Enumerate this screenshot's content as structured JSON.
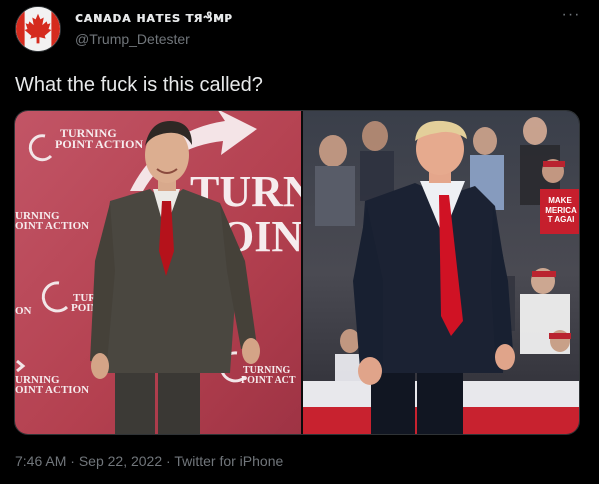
{
  "author": {
    "display_name": "ᴄᴀɴᴀᴅᴀ нᴀᴛᴇs тя₰ᴍᴘ",
    "handle": "@Trump_Detester",
    "avatar_icon": "maple-leaf-icon"
  },
  "more_icon": "more-options-icon",
  "more_label": "···",
  "tweet": {
    "text": "What the fuck is this called?"
  },
  "media": {
    "left_photo": {
      "logo_top": "TURNING\nPOINT ACTION",
      "logo_left": "URNING\nOINT ACTION",
      "logo_mid_left": "TURN\nPOIN",
      "logo_bottom_left": "URNING\nOINT ACTION",
      "logo_bottom_center": "TURNING\nPOINT ACT",
      "big_text": "TURN\nOIN",
      "edge_text_on": "ON"
    },
    "right_photo": {
      "sign_text": "MAKE\nMERICA\nT AGAI"
    }
  },
  "meta": {
    "time": "7:46 AM",
    "separator": " · ",
    "date": "Sep 22, 2022",
    "source": "Twitter for iPhone"
  },
  "colors": {
    "background": "#000000",
    "text_primary": "#e7e9ea",
    "text_secondary": "#71767b",
    "backdrop_red": "#b5323f",
    "suit_red_tie": "#c8102e"
  }
}
